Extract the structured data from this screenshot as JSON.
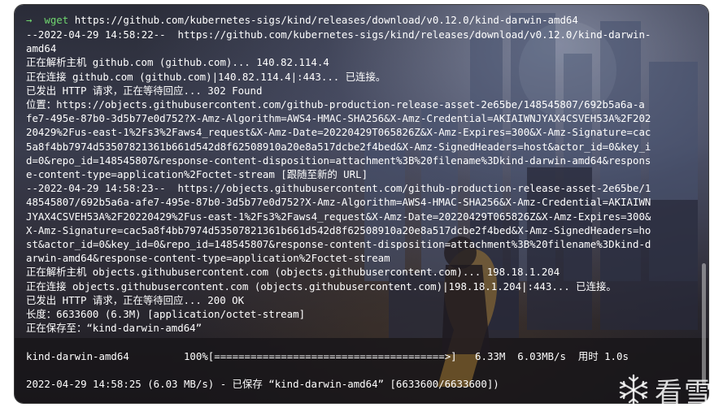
{
  "terminal": {
    "prompt_arrow": "→",
    "prompt_command": "wget",
    "command_args": " https://github.com/kubernetes-sigs/kind/releases/download/v0.12.0/kind-darwin-amd64",
    "lines": [
      "--2022-04-29 14:58:22--  https://github.com/kubernetes-sigs/kind/releases/download/v0.12.0/kind-darwin-",
      "amd64",
      "正在解析主机 github.com (github.com)... 140.82.114.4",
      "正在连接 github.com (github.com)|140.82.114.4|:443... 已连接。",
      "已发出 HTTP 请求，正在等待回应... 302 Found",
      "位置：https://objects.githubusercontent.com/github-production-release-asset-2e65be/148545807/692b5a6a-a",
      "fe7-495e-87b0-3d5b77e0d752?X-Amz-Algorithm=AWS4-HMAC-SHA256&X-Amz-Credential=AKIAIWNJYAX4CSVEH53A%2F202",
      "20429%2Fus-east-1%2Fs3%2Faws4_request&X-Amz-Date=20220429T065826Z&X-Amz-Expires=300&X-Amz-Signature=cac",
      "5a8f4bb7974d53507821361b661d542d8f62508910a20e8a517dcbe2f4bed&X-Amz-SignedHeaders=host&actor_id=0&key_i",
      "d=0&repo_id=148545807&response-content-disposition=attachment%3B%20filename%3Dkind-darwin-amd64&respons",
      "e-content-type=application%2Foctet-stream [跟随至新的 URL]",
      "--2022-04-29 14:58:23--  https://objects.githubusercontent.com/github-production-release-asset-2e65be/1",
      "48545807/692b5a6a-afe7-495e-87b0-3d5b77e0d752?X-Amz-Algorithm=AWS4-HMAC-SHA256&X-Amz-Credential=AKIAIWN",
      "JYAX4CSVEH53A%2F20220429%2Fus-east-1%2Fs3%2Faws4_request&X-Amz-Date=20220429T065826Z&X-Amz-Expires=300&",
      "X-Amz-Signature=cac5a8f4bb7974d53507821361b661d542d8f62508910a20e8a517dcbe2f4bed&X-Amz-SignedHeaders=ho",
      "st&actor_id=0&key_id=0&repo_id=148545807&response-content-disposition=attachment%3B%20filename%3Dkind-d",
      "arwin-amd64&response-content-type=application%2Foctet-stream",
      "正在解析主机 objects.githubusercontent.com (objects.githubusercontent.com)... 198.18.1.204",
      "正在连接 objects.githubusercontent.com (objects.githubusercontent.com)|198.18.1.204|:443... 已连接。",
      "已发出 HTTP 请求，正在等待回应... 200 OK",
      "长度：6633600 (6.3M) [application/octet-stream]",
      "正在保存至：“kind-darwin-amd64”",
      "",
      "kind-darwin-amd64         100%[======================================>]   6.33M  6.03MB/s  用时 1.0s",
      "",
      "2022-04-29 14:58:25 (6.03 MB/s) - 已保存 “kind-darwin-amd64” [6633600/6633600])"
    ]
  },
  "watermark": {
    "text": "看雪",
    "icon": "snowflake-icon"
  }
}
